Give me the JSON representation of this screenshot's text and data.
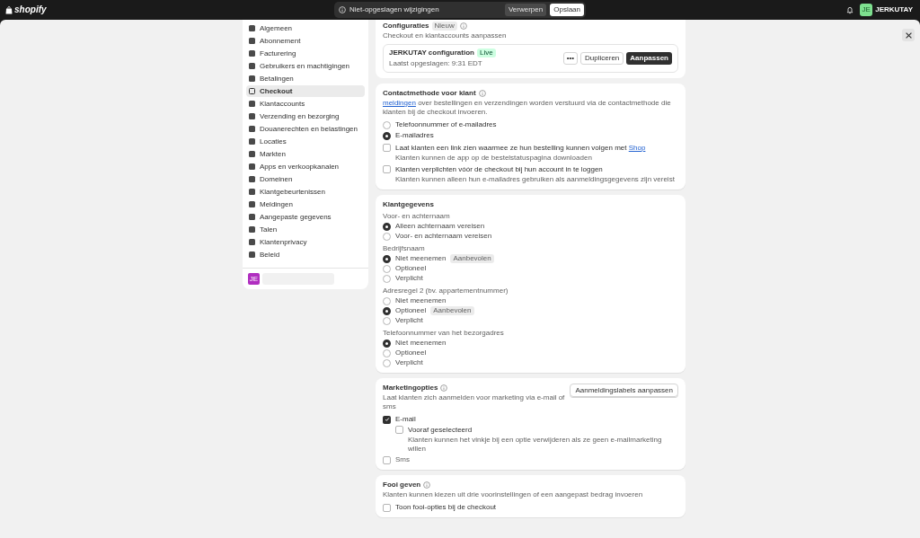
{
  "topbar": {
    "logo": "shopify",
    "notice": "Niet-opgeslagen wijzigingen",
    "discard": "Verwerpen",
    "save": "Opslaan",
    "avatar": "JE",
    "store": "JERKUTAY"
  },
  "sidebar": {
    "items": [
      {
        "label": "Algemeen",
        "selected": false
      },
      {
        "label": "Abonnement",
        "selected": false
      },
      {
        "label": "Facturering",
        "selected": false
      },
      {
        "label": "Gebruikers en machtigingen",
        "selected": false
      },
      {
        "label": "Betalingen",
        "selected": false
      },
      {
        "label": "Checkout",
        "selected": true
      },
      {
        "label": "Klantaccounts",
        "selected": false
      },
      {
        "label": "Verzending en bezorging",
        "selected": false
      },
      {
        "label": "Douanerechten en belastingen",
        "selected": false
      },
      {
        "label": "Locaties",
        "selected": false
      },
      {
        "label": "Markten",
        "selected": false
      },
      {
        "label": "Apps en verkoopkanalen",
        "selected": false
      },
      {
        "label": "Domeinen",
        "selected": false
      },
      {
        "label": "Klantgebeurtenissen",
        "selected": false
      },
      {
        "label": "Meldingen",
        "selected": false
      },
      {
        "label": "Aangepaste gegevens",
        "selected": false
      },
      {
        "label": "Talen",
        "selected": false
      },
      {
        "label": "Klantenprivacy",
        "selected": false
      },
      {
        "label": "Beleid",
        "selected": false
      }
    ],
    "store_badge": "JE"
  },
  "configurations": {
    "title": "Configuraties",
    "badge": "Nieuw",
    "subtitle": "Checkout en klantaccounts aanpassen",
    "config_name": "JERKUTAY configuration",
    "status": "Live",
    "saved": "Laatst opgeslagen: 9:31 EDT",
    "more": "•••",
    "duplicate": "Dupliceren",
    "customize": "Aanpassen"
  },
  "contact": {
    "title": "Contactmethode voor klant",
    "link": "meldingen",
    "description": " over bestellingen en verzendingen worden verstuurd via de contactmethode die klanten bij de checkout invoeren.",
    "options": [
      {
        "label": "Telefoonnummer of e-mailadres",
        "selected": false
      },
      {
        "label": "E-mailadres",
        "selected": true
      }
    ],
    "checkboxes": [
      {
        "label": "Laat klanten een link zien waarmee ze hun bestelling kunnen volgen met ",
        "link": "Shop",
        "hint": "Klanten kunnen de app op de bestelstatuspagina downloaden",
        "checked": false
      },
      {
        "label": "Klanten verplichten vóór de checkout bij hun account in te loggen",
        "hint": "Klanten kunnen alleen hun e-mailadres gebruiken als aanmeldingsgegevens zijn vereist",
        "checked": false
      }
    ]
  },
  "customer_info": {
    "title": "Klantgegevens",
    "groups": [
      {
        "label": "Voor- en achternaam",
        "options": [
          {
            "label": "Alleen achternaam vereisen",
            "selected": true
          },
          {
            "label": "Voor- en achternaam vereisen",
            "selected": false
          }
        ]
      },
      {
        "label": "Bedrijfsnaam",
        "options": [
          {
            "label": "Niet meenemen",
            "badge": "Aanbevolen",
            "selected": true
          },
          {
            "label": "Optioneel",
            "selected": false
          },
          {
            "label": "Verplicht",
            "selected": false
          }
        ]
      },
      {
        "label": "Adresregel 2 (bv. appartementnummer)",
        "options": [
          {
            "label": "Niet meenemen",
            "selected": false
          },
          {
            "label": "Optioneel",
            "badge": "Aanbevolen",
            "selected": true
          },
          {
            "label": "Verplicht",
            "selected": false
          }
        ]
      },
      {
        "label": "Telefoonnummer van het bezorgadres",
        "options": [
          {
            "label": "Niet meenemen",
            "selected": true
          },
          {
            "label": "Optioneel",
            "selected": false
          },
          {
            "label": "Verplicht",
            "selected": false
          }
        ]
      }
    ]
  },
  "marketing": {
    "title": "Marketingopties",
    "subtitle": "Laat klanten zich aanmelden voor marketing via e-mail of sms",
    "button": "Aanmeldingslabels aanpassen",
    "email": {
      "label": "E-mail",
      "checked": true
    },
    "preselect": {
      "label": "Vooraf geselecteerd",
      "hint": "Klanten kunnen het vinkje bij een optie verwijderen als ze geen e-mailmarketing willen",
      "checked": false
    },
    "sms": {
      "label": "Sms",
      "checked": false
    }
  },
  "tipping": {
    "title": "Fooi geven",
    "subtitle": "Klanten kunnen kiezen uit drie voorinstellingen of een aangepast bedrag invoeren",
    "checkbox": {
      "label": "Toon fooi-opties bij de checkout",
      "checked": false
    }
  }
}
